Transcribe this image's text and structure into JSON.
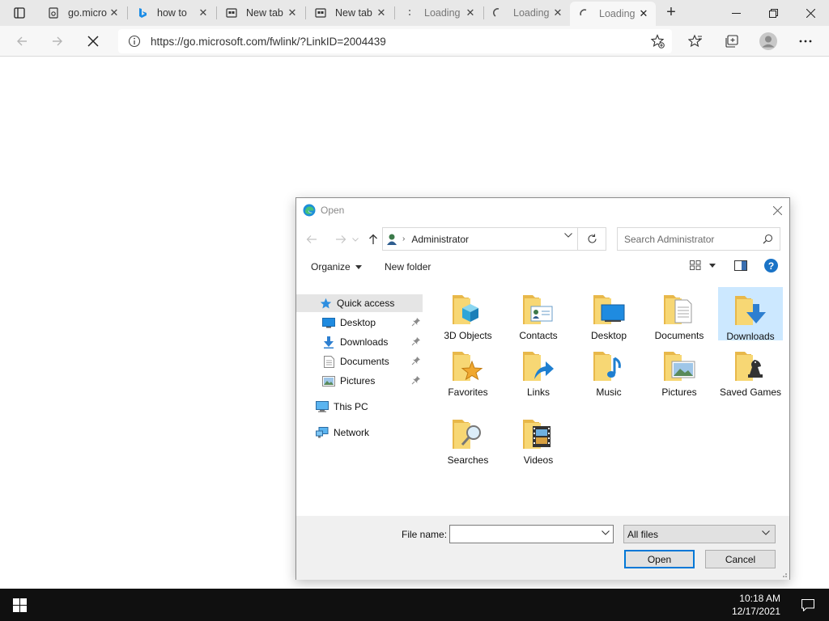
{
  "browser": {
    "tabs": [
      {
        "label": "go.microsoft.com",
        "icon": "page-icon"
      },
      {
        "label": "how to",
        "icon": "bing-icon"
      },
      {
        "label": "New tab",
        "icon": "newtab-icon"
      },
      {
        "label": "New tab",
        "icon": "newtab-icon"
      },
      {
        "label": "Loading",
        "icon": "loading-icon"
      },
      {
        "label": "Loading",
        "icon": "loading-icon"
      },
      {
        "label": "Loading",
        "icon": "loading-icon"
      }
    ],
    "address": {
      "url": "https://go.microsoft.com/fwlink/?LinkID=2004439"
    }
  },
  "dialog": {
    "title": "Open",
    "path": [
      "Administrator"
    ],
    "search_placeholder": "Search Administrator",
    "commands": {
      "organize": "Organize",
      "new_folder": "New folder"
    },
    "nav": {
      "quick_access": "Quick access",
      "quick_items": [
        {
          "label": "Desktop",
          "icon": "desktop-icon"
        },
        {
          "label": "Downloads",
          "icon": "downloads-icon"
        },
        {
          "label": "Documents",
          "icon": "documents-icon"
        },
        {
          "label": "Pictures",
          "icon": "pictures-icon"
        }
      ],
      "this_pc": "This PC",
      "network": "Network"
    },
    "files": [
      {
        "label": "3D Objects",
        "icon": "3d-objects-folder-icon"
      },
      {
        "label": "Contacts",
        "icon": "contacts-folder-icon"
      },
      {
        "label": "Desktop",
        "icon": "desktop-folder-icon"
      },
      {
        "label": "Documents",
        "icon": "documents-folder-icon"
      },
      {
        "label": "Downloads",
        "icon": "downloads-folder-icon",
        "selected": true
      },
      {
        "label": "Favorites",
        "icon": "favorites-folder-icon"
      },
      {
        "label": "Links",
        "icon": "links-folder-icon"
      },
      {
        "label": "Music",
        "icon": "music-folder-icon"
      },
      {
        "label": "Pictures",
        "icon": "pictures-folder-icon"
      },
      {
        "label": "Saved Games",
        "icon": "saved-games-folder-icon"
      },
      {
        "label": "Searches",
        "icon": "searches-folder-icon"
      },
      {
        "label": "Videos",
        "icon": "videos-folder-icon"
      }
    ],
    "file_name_label": "File name:",
    "file_name_value": "",
    "file_type": "All files",
    "open_label": "Open",
    "cancel_label": "Cancel"
  },
  "taskbar": {
    "time": "10:18 AM",
    "date": "12/17/2021"
  },
  "colors": {
    "folder": "#f3cd5d",
    "accent": "#0078d7",
    "selection": "#cce8ff"
  }
}
